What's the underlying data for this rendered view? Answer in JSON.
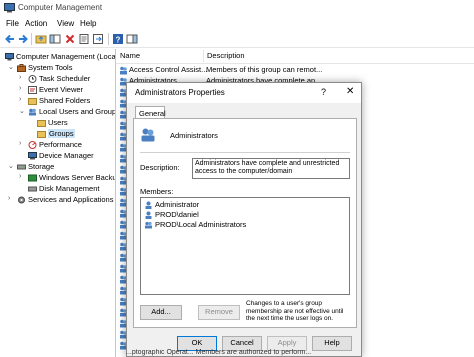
{
  "window": {
    "title": "Computer Management"
  },
  "menu": [
    "File",
    "Action",
    "View",
    "Help"
  ],
  "tree": {
    "root": "Computer Management (Local",
    "system_tools": "System Tools",
    "task_scheduler": "Task Scheduler",
    "event_viewer": "Event Viewer",
    "shared_folders": "Shared Folders",
    "local_users_groups": "Local Users and Groups",
    "users": "Users",
    "groups": "Groups",
    "performance": "Performance",
    "device_manager": "Device Manager",
    "storage": "Storage",
    "wsb": "Windows Server Backup",
    "disk_management": "Disk Management",
    "services_apps": "Services and Applications"
  },
  "list": {
    "col_name": "Name",
    "col_desc": "Description",
    "rows": [
      {
        "name": "Access Control Assist...",
        "desc": "Members of this group can remot..."
      },
      {
        "name": "Administrators",
        "desc": "Administrators have complete an..."
      }
    ],
    "bottom_partial": "...ptographic Operat... Members are authorized to perform..."
  },
  "dialog": {
    "title": "Administrators Properties",
    "help": "?",
    "close": "✕",
    "tab": "General",
    "group_name": "Administrators",
    "description_label": "Description:",
    "description_value": "Administrators have complete and unrestricted access to the computer/domain",
    "members_label": "Members:",
    "members": [
      "Administrator",
      "PROD\\daniel",
      "PROD\\Local Administrators"
    ],
    "add_button": "Add...",
    "remove_button": "Remove",
    "note": "Changes to a user's group membership are not effective until the next time the user logs on.",
    "ok": "OK",
    "cancel": "Cancel",
    "apply": "Apply",
    "help_button": "Help"
  },
  "colors": {
    "accent": "#0078d7",
    "selection": "#cce4f7",
    "folder": "#e8c15a"
  }
}
